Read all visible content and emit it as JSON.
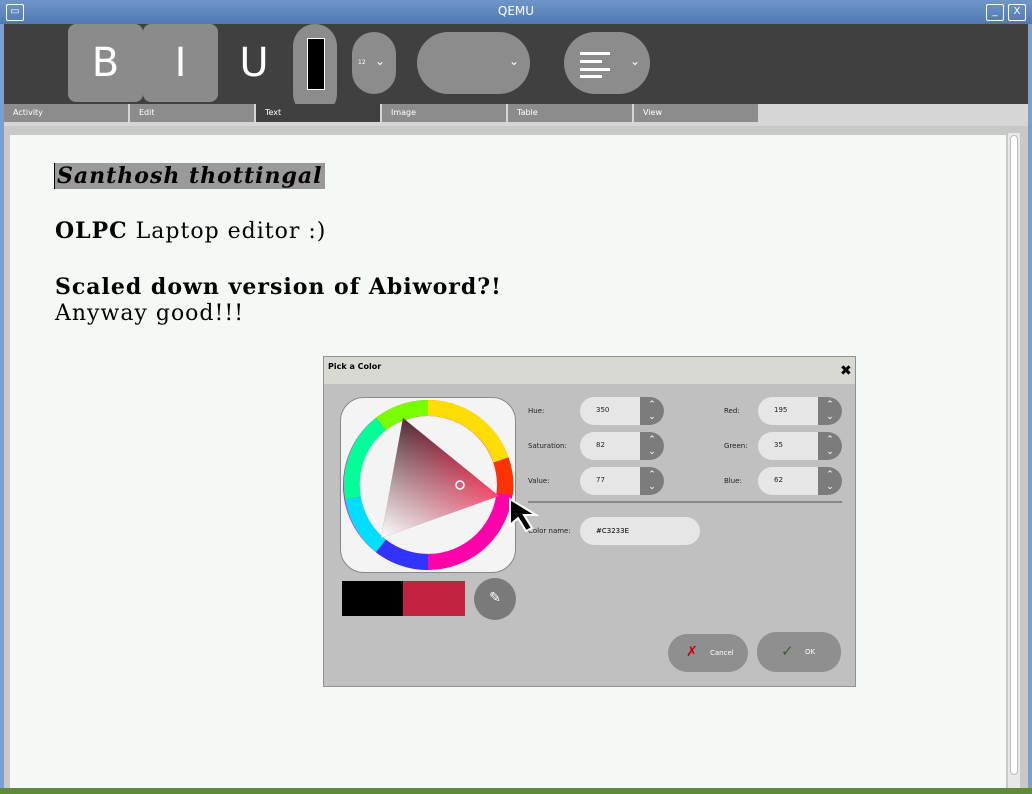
{
  "window": {
    "title": "QEMU",
    "minimize": "_",
    "close": "X"
  },
  "toolbar": {
    "bold": "B",
    "italic": "I",
    "underline": "U",
    "font_size": "12"
  },
  "tabs": [
    "Activity",
    "Edit",
    "Text",
    "Image",
    "Table",
    "View"
  ],
  "active_tab": "Text",
  "document": {
    "line1": "Santhosh thottingal",
    "line2_bold": "OLPC",
    "line2_rest": " Laptop editor :)",
    "line3": "Scaled down version of Abiword?!",
    "line4": "Anyway good!!!"
  },
  "dialog": {
    "title": "Pick a Color",
    "hue_label": "Hue:",
    "hue": "350",
    "saturation_label": "Saturation:",
    "saturation": "82",
    "value_label": "Value:",
    "value": "77",
    "red_label": "Red:",
    "red": "195",
    "green_label": "Green:",
    "green": "35",
    "blue_label": "Blue:",
    "blue": "62",
    "color_name_label": "Color name:",
    "color_name": "#C3233E",
    "cancel": "Cancel",
    "ok": "OK",
    "current_color": "#c3233e",
    "previous_color": "#000000"
  },
  "colors": {
    "titlebar": "#4f79b3",
    "toolbar": "#404040",
    "accent": "#c3233e"
  }
}
